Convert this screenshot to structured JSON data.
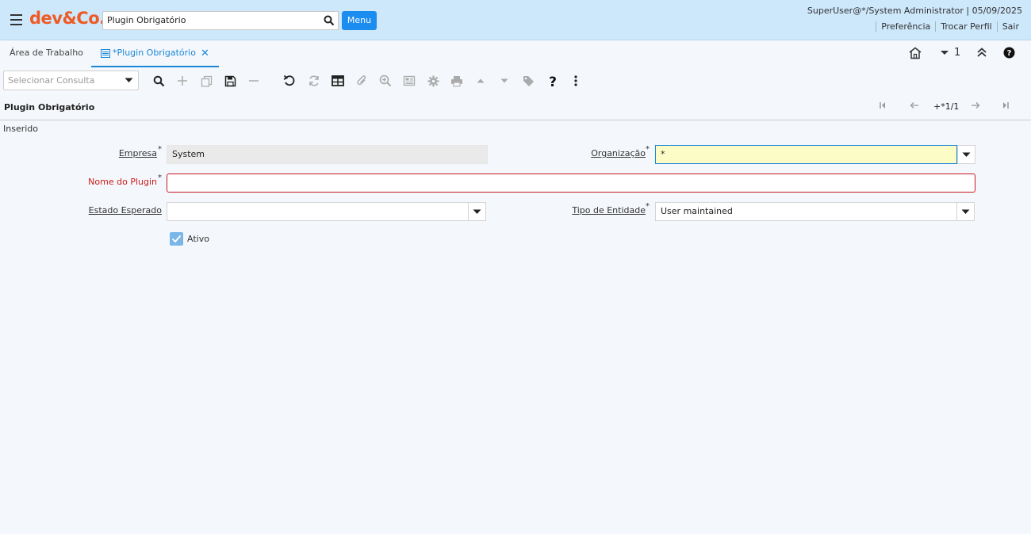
{
  "header": {
    "logo": "dev&Co.",
    "search_value": "Plugin Obrigatório",
    "menu_label": "Menu",
    "user_info": "SuperUser@*/System Administrator | 05/09/2025",
    "links": [
      "Preferência",
      "Trocar Perfil",
      "Sair"
    ]
  },
  "tabs": {
    "home_label": "Área de Trabalho",
    "active_label": "*Plugin Obrigatório",
    "count": "1"
  },
  "toolbar": {
    "consulta_placeholder": "Selecionar Consulta"
  },
  "record": {
    "title": "Plugin Obrigatório",
    "position": "+*1/1",
    "status": "Inserido"
  },
  "form": {
    "empresa_label": "Empresa",
    "empresa_value": "System",
    "organizacao_label": "Organização",
    "organizacao_value": "*",
    "nome_label": "Nome do Plugin",
    "nome_value": "",
    "estado_label": "Estado Esperado",
    "estado_value": "",
    "tipo_label": "Tipo de Entidade",
    "tipo_value": "User maintained",
    "ativo_label": "Ativo",
    "ativo_checked": true
  },
  "colors": {
    "header_bg": "#cde7fb",
    "logo": "#ee5a24",
    "accent": "#1a88d8",
    "error": "#cc1b1b"
  }
}
